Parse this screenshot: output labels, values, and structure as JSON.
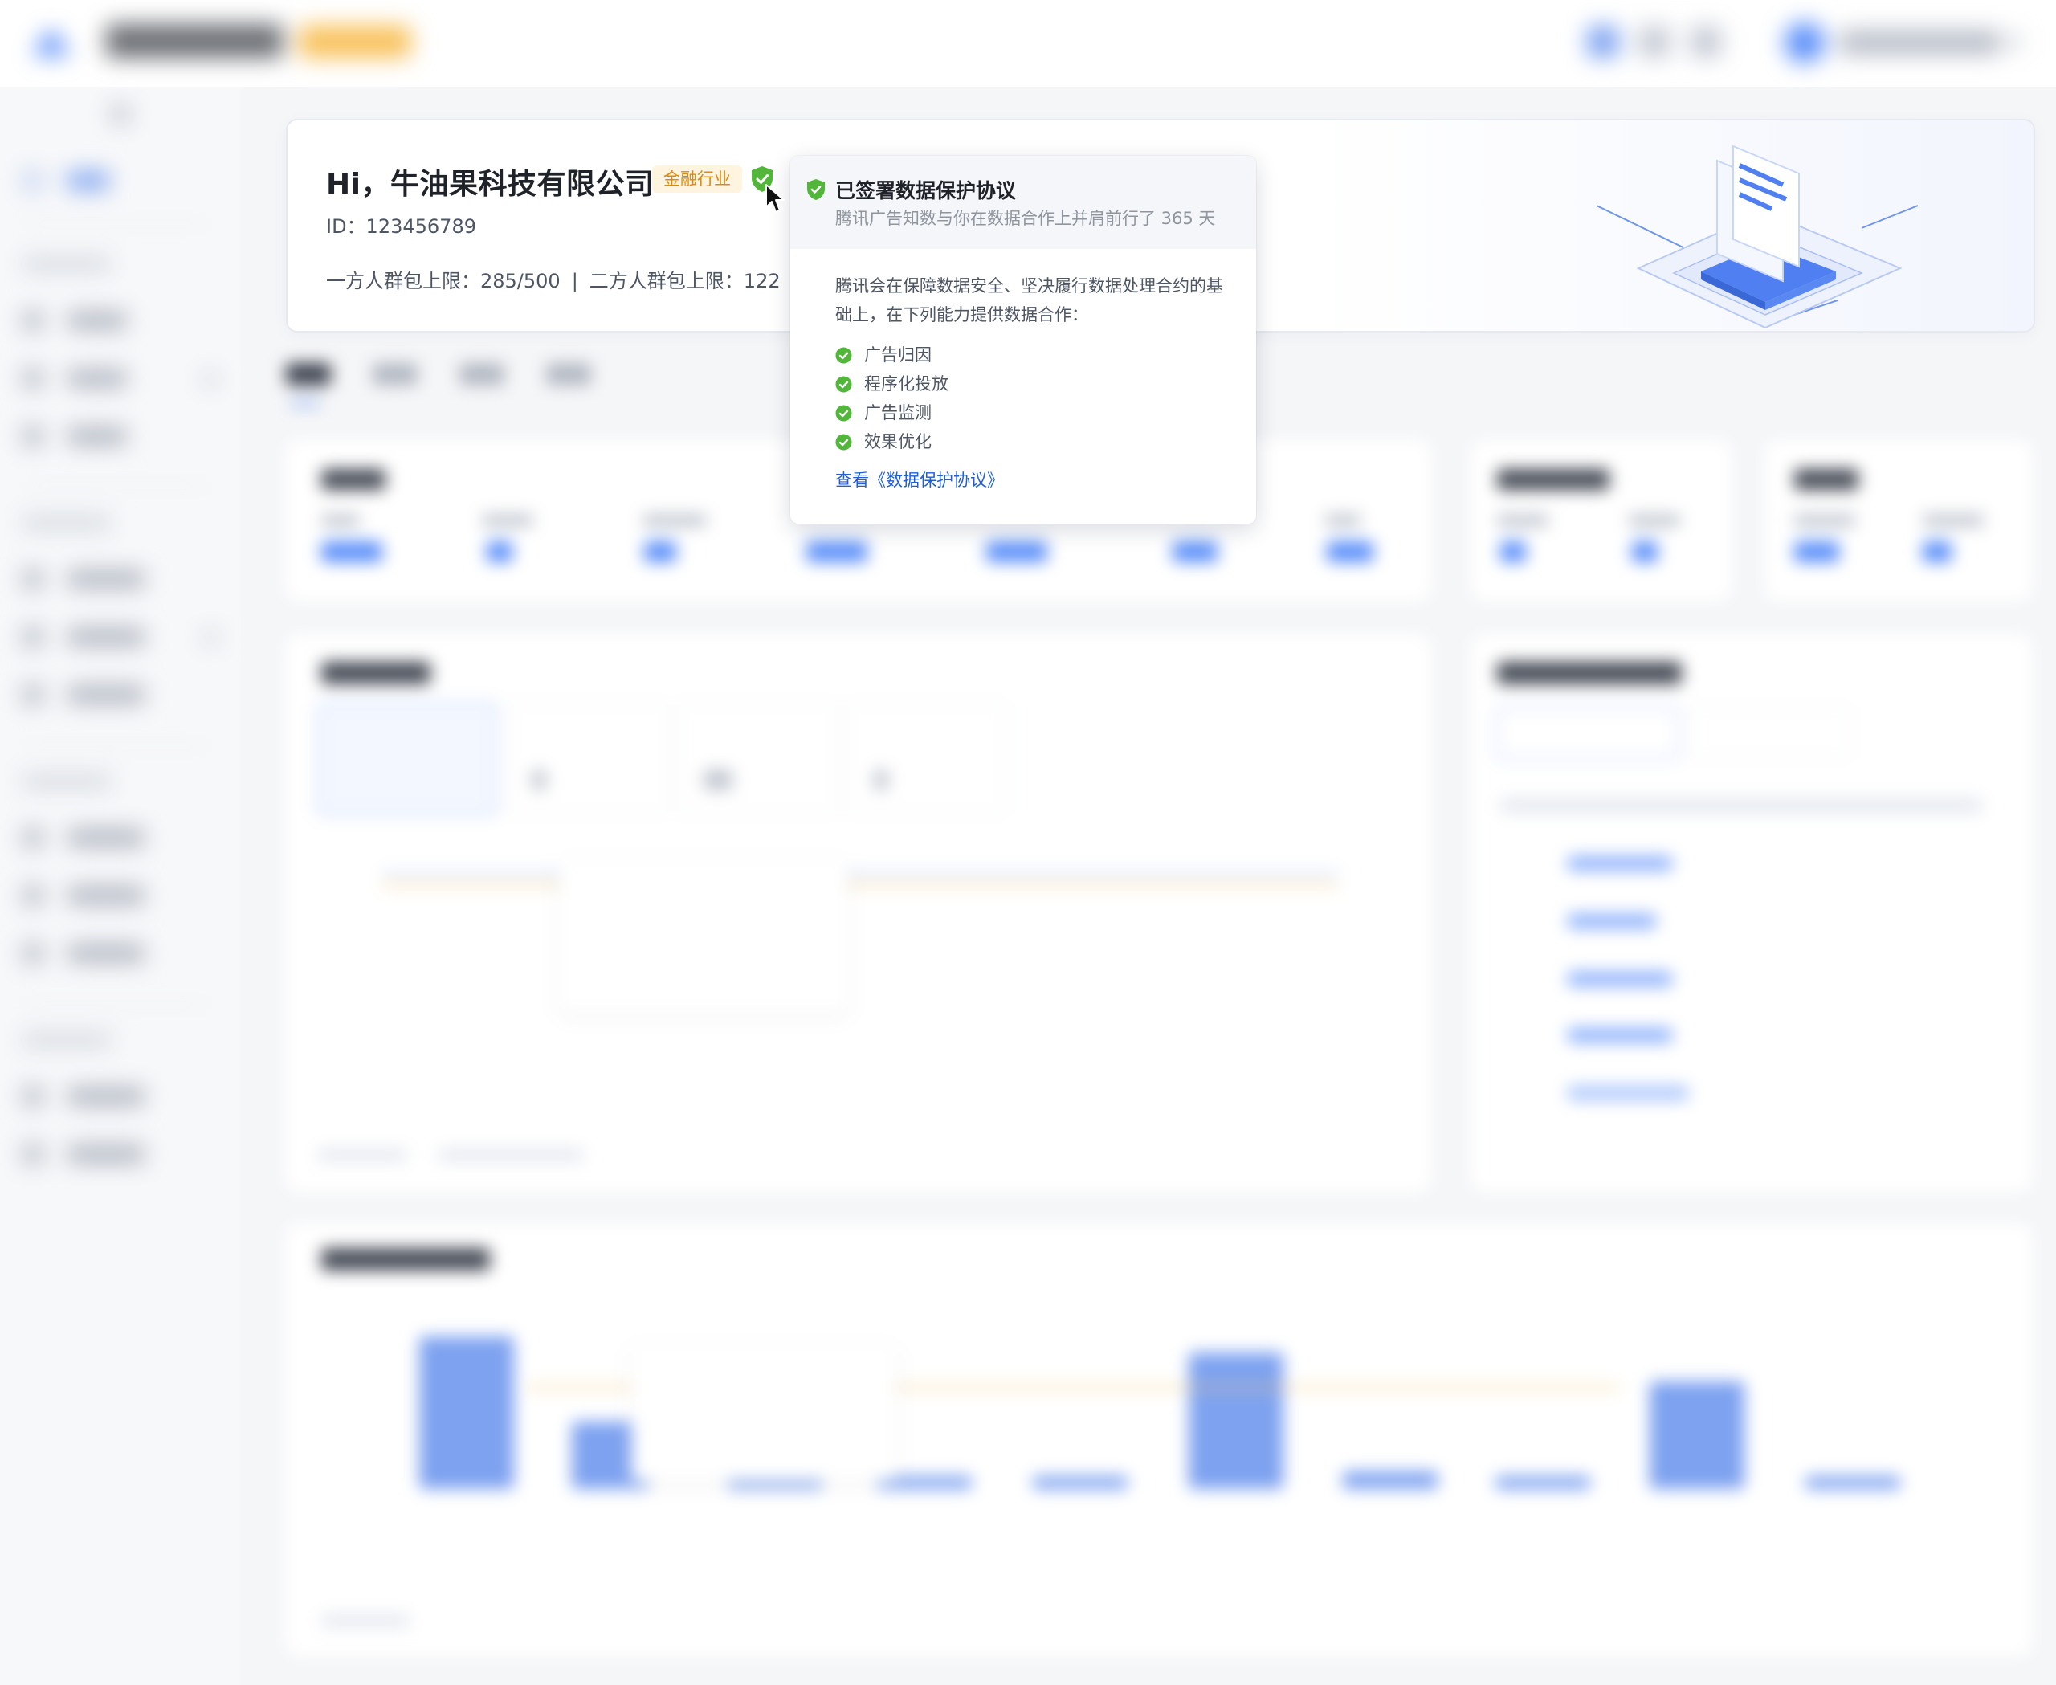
{
  "header": {
    "greeting": "Hi，牛油果科技有限公司",
    "industry_tag": "金融行业",
    "account_id": "ID：123456789",
    "first_party_quota": "一方人群包上限：285/500",
    "separator": "|",
    "second_party_quota": "二方人群包上限：122"
  },
  "popover": {
    "title": "已签署数据保护协议",
    "subtitle": "腾讯广告知数与你在数据合作上并肩前行了 365 天",
    "description": "腾讯会在保障数据安全、坚决履行数据处理合约的基础上，在下列能力提供数据合作：",
    "capabilities": [
      "广告归因",
      "程序化投放",
      "广告监测",
      "效果优化"
    ],
    "link_label": "查看《数据保护协议》"
  },
  "colors": {
    "accent": "#1f5ed8",
    "success": "#52b63a",
    "tag_bg": "#fff4e0",
    "tag_text": "#d98a14",
    "chart_bar": "#5b8ff9",
    "chart_line": "#f6c25a"
  },
  "icons": {
    "verified": "shield-check-icon",
    "capability_ok": "check-circle-icon",
    "pointer": "mouse-cursor-icon"
  }
}
